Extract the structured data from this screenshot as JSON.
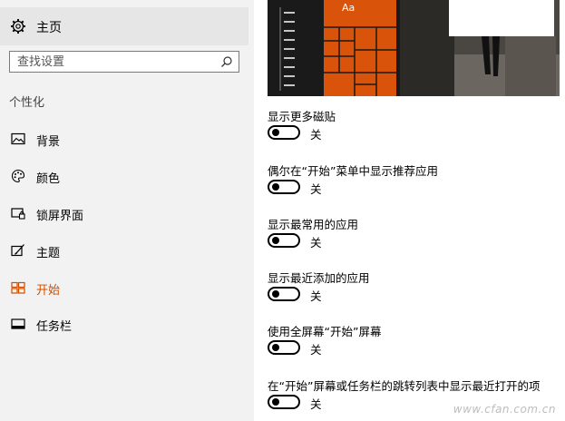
{
  "sidebar": {
    "home_label": "主页",
    "search_placeholder": "查找设置",
    "section_label": "个性化",
    "items": [
      {
        "label": "背景",
        "icon": "picture-icon",
        "active": false
      },
      {
        "label": "颜色",
        "icon": "palette-icon",
        "active": false
      },
      {
        "label": "锁屏界面",
        "icon": "lock-screen-icon",
        "active": false
      },
      {
        "label": "主题",
        "icon": "brush-icon",
        "active": false
      },
      {
        "label": "开始",
        "icon": "start-icon",
        "active": true
      },
      {
        "label": "任务栏",
        "icon": "taskbar-icon",
        "active": false
      }
    ]
  },
  "preview": {
    "tile_text": "Aa",
    "accent_color": "#d9540a"
  },
  "settings": [
    {
      "title": "显示更多磁贴",
      "state": "关"
    },
    {
      "title": "偶尔在“开始”菜单中显示推荐应用",
      "state": "关"
    },
    {
      "title": "显示最常用的应用",
      "state": "关"
    },
    {
      "title": "显示最近添加的应用",
      "state": "关"
    },
    {
      "title": "使用全屏幕“开始”屏幕",
      "state": "关"
    },
    {
      "title": "在“开始”屏幕或任务栏的跳转列表中显示最近打开的项",
      "state": "关"
    }
  ],
  "watermark": "www.cfan.com.cn",
  "colors": {
    "accent": "#d04e00",
    "sidebar_bg": "#f2f2f2",
    "home_bg": "#e6e6e6"
  }
}
